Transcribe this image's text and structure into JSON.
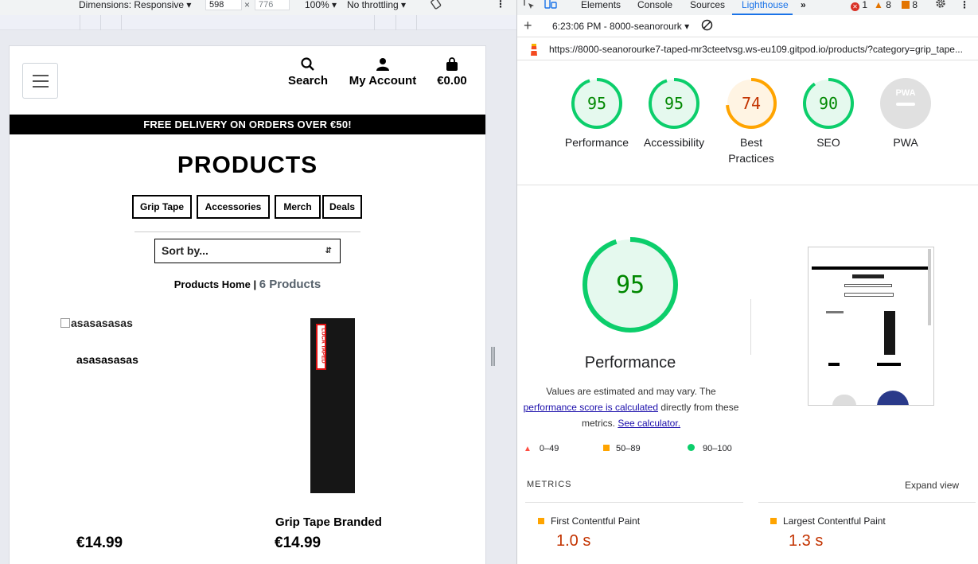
{
  "device_toolbar": {
    "dimensions_label": "Dimensions: Responsive",
    "width": "598",
    "times": "×",
    "height": "776",
    "zoom": "100%",
    "throttling": "No throttling"
  },
  "site": {
    "nav": {
      "search_label": "Search",
      "account_label": "My Account",
      "cart_total": "€0.00"
    },
    "banner_text": "FREE DELIVERY ON ORDERS OVER €50!",
    "page_title": "PRODUCTS",
    "categories": [
      "Grip Tape",
      "Accessories",
      "Merch",
      "Deals"
    ],
    "sort_placeholder": "Sort by...",
    "breadcrumb_home": "Products Home",
    "breadcrumb_sep": "|",
    "breadcrumb_count": "6 Products",
    "products": [
      {
        "broken_image_alt": "asasasasas",
        "name": "asasasasas",
        "price": "€14.99"
      },
      {
        "image_label": "LUCA TAPED",
        "name": "Grip Tape Branded",
        "price": "€14.99"
      }
    ]
  },
  "devtools": {
    "tabs": [
      "Elements",
      "Console",
      "Sources",
      "Lighthouse"
    ],
    "active_tab": "Lighthouse",
    "more_tabs": "»",
    "issues": {
      "errors": "1",
      "warnings": "8",
      "info": "8"
    },
    "report_label": "6:23:06 PM - 8000-seanorourk",
    "url": "https://8000-seanorourke7-taped-mr3cteetvsg.ws-eu109.gitpod.io/products/?category=grip_tape...",
    "scores": [
      {
        "label": "Performance",
        "value": "95",
        "status": "pass"
      },
      {
        "label": "Accessibility",
        "value": "95",
        "status": "pass"
      },
      {
        "label": "Best Practices",
        "value": "74",
        "status": "average"
      },
      {
        "label": "SEO",
        "value": "90",
        "status": "pass"
      },
      {
        "label": "PWA",
        "value": "PWA",
        "status": "na"
      }
    ],
    "big_score": {
      "value": "95",
      "label": "Performance"
    },
    "note_prefix": "Values are estimated and may vary. The",
    "note_link1": "performance score is calculated",
    "note_middle": "directly from these metrics.",
    "note_link2": "See calculator.",
    "legend": [
      "0–49",
      "50–89",
      "90–100"
    ],
    "metrics_heading": "METRICS",
    "expand_view": "Expand view",
    "metrics": [
      {
        "name": "First Contentful Paint",
        "value": "1.0 s"
      },
      {
        "name": "Largest Contentful Paint",
        "value": "1.3 s"
      }
    ],
    "colors": {
      "pass": "#0cce6b",
      "average": "#ffa400",
      "fail": "#ff4e42",
      "link": "#1a73e8"
    }
  }
}
